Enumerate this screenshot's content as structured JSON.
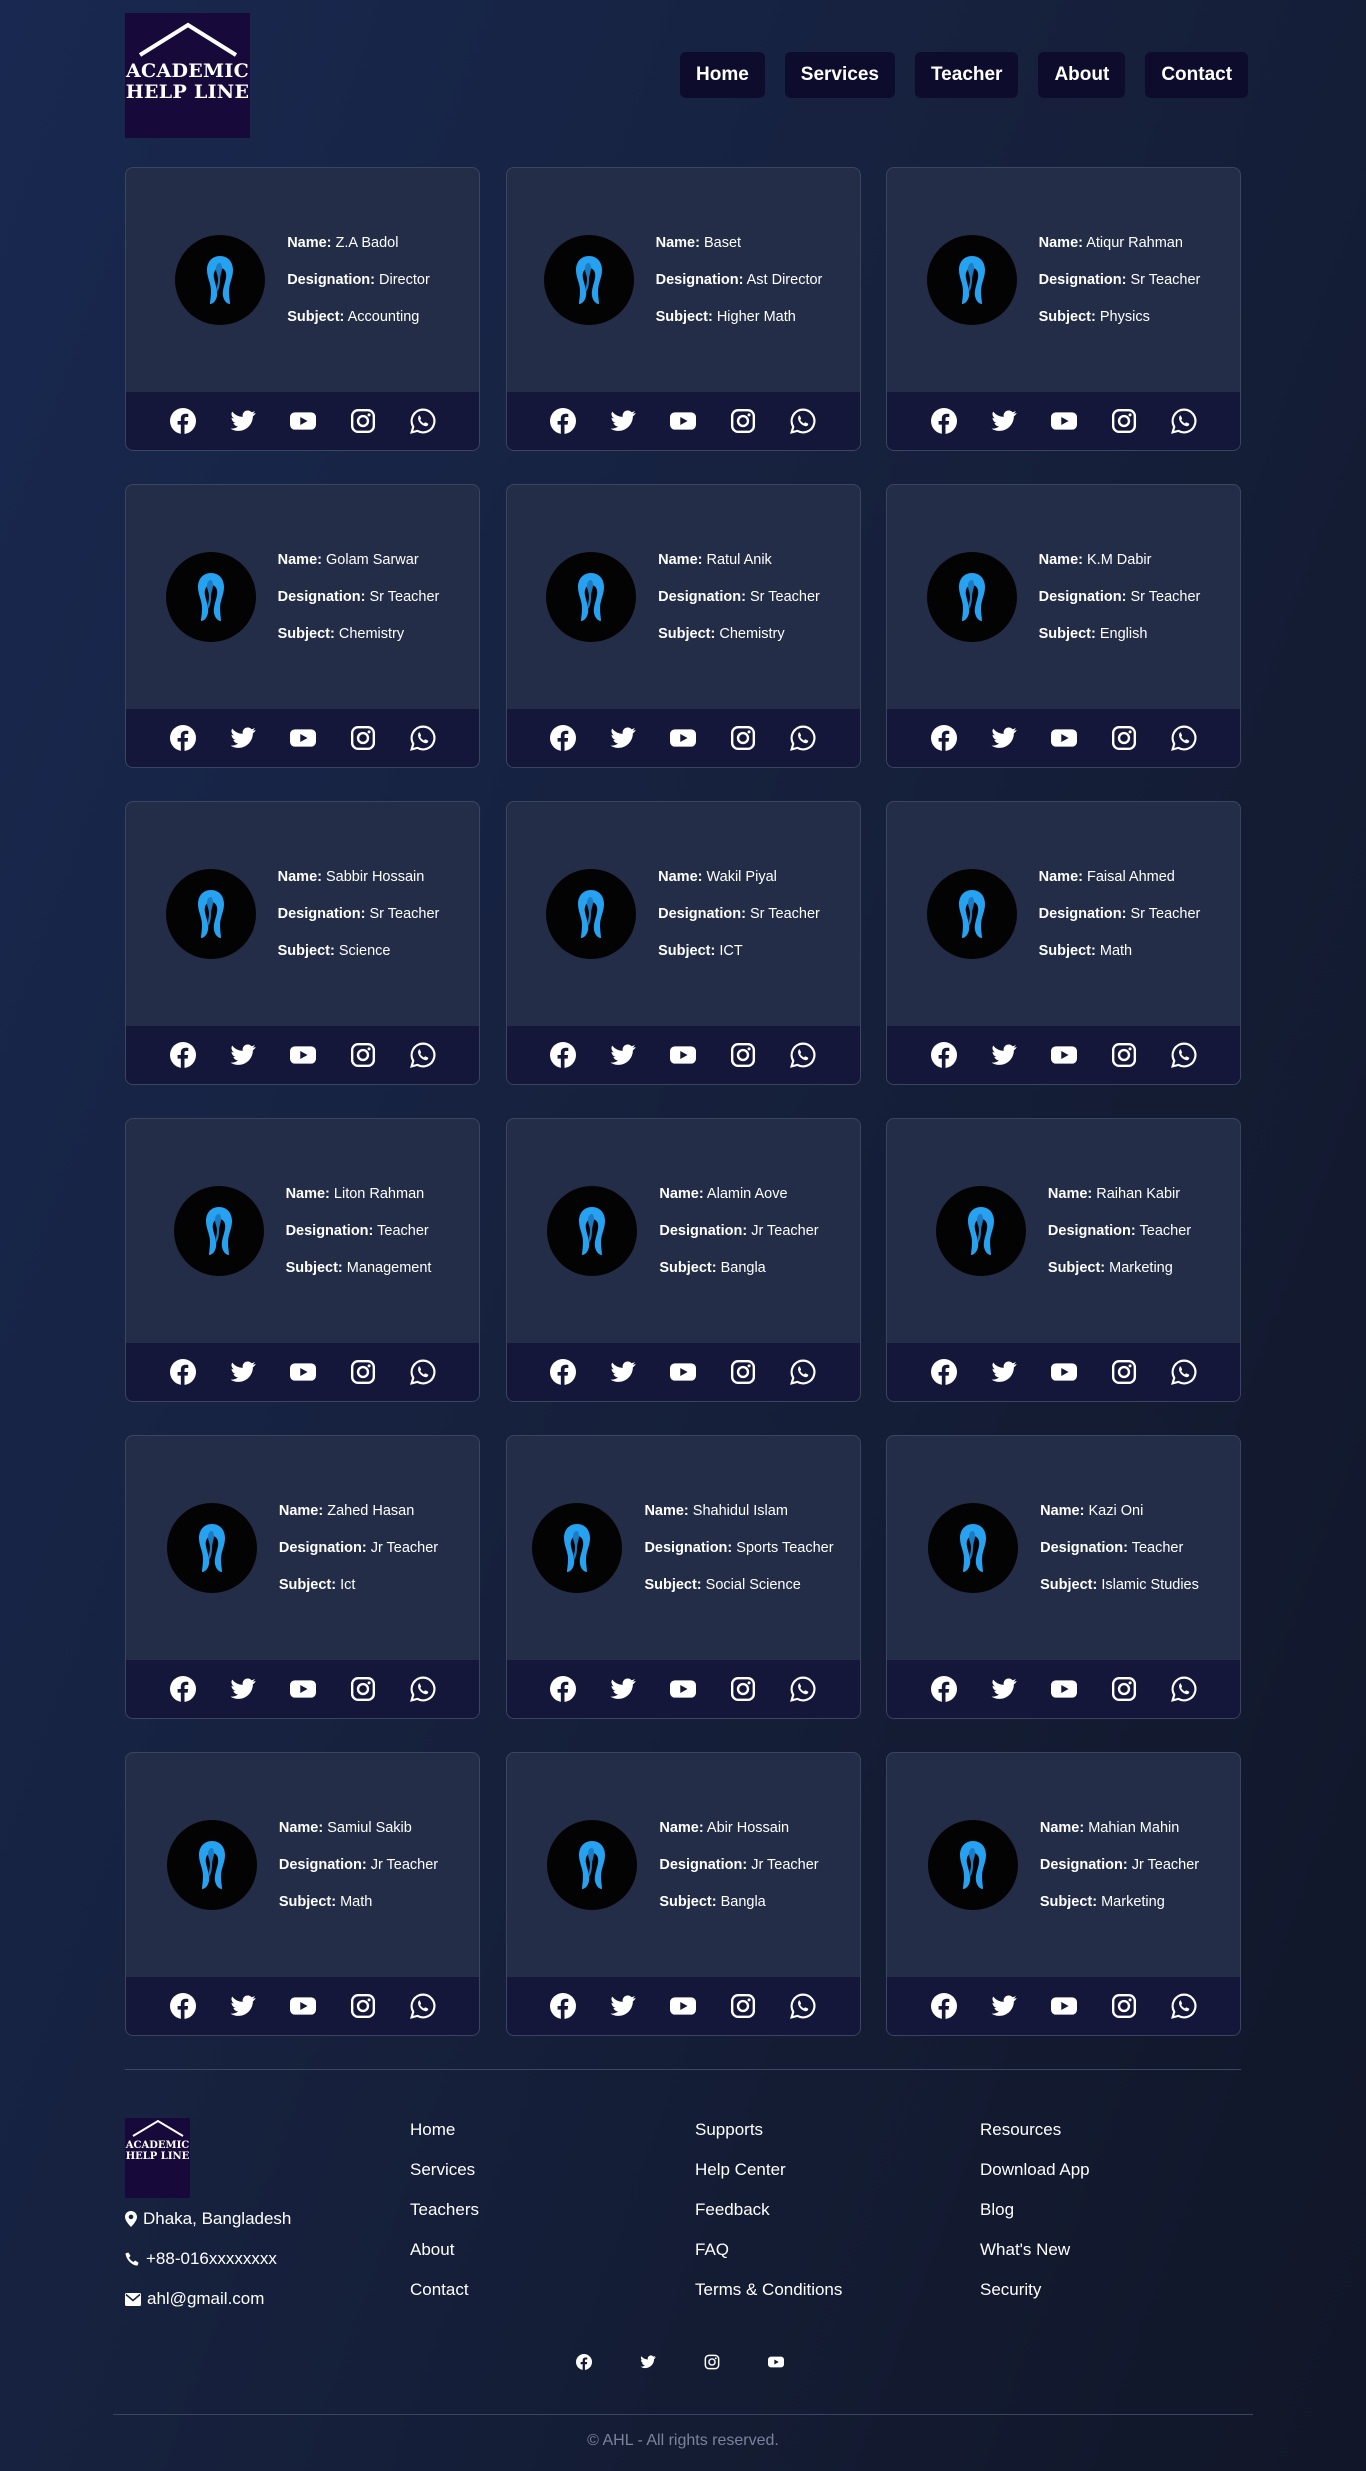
{
  "header": {
    "logo_line1": "ACADEMIC",
    "logo_line2": "HELP LINE",
    "nav": [
      {
        "label": "Home"
      },
      {
        "label": "Services"
      },
      {
        "label": "Teacher"
      },
      {
        "label": "About"
      },
      {
        "label": "Contact"
      }
    ]
  },
  "labels": {
    "name": "Name:",
    "designation": "Designation:",
    "subject": "Subject:"
  },
  "teachers": [
    {
      "name": "Z.A Badol",
      "designation": "Director",
      "subject": "Accounting"
    },
    {
      "name": "Baset",
      "designation": "Ast Director",
      "subject": "Higher Math"
    },
    {
      "name": "Atiqur Rahman",
      "designation": "Sr Teacher",
      "subject": "Physics"
    },
    {
      "name": "Golam Sarwar",
      "designation": "Sr Teacher",
      "subject": "Chemistry"
    },
    {
      "name": "Ratul Anik",
      "designation": "Sr Teacher",
      "subject": "Chemistry"
    },
    {
      "name": "K.M Dabir",
      "designation": "Sr Teacher",
      "subject": "English"
    },
    {
      "name": "Sabbir Hossain",
      "designation": "Sr Teacher",
      "subject": "Science"
    },
    {
      "name": "Wakil Piyal",
      "designation": "Sr Teacher",
      "subject": "ICT"
    },
    {
      "name": "Faisal Ahmed",
      "designation": "Sr Teacher",
      "subject": "Math"
    },
    {
      "name": "Liton Rahman",
      "designation": "Teacher",
      "subject": "Management"
    },
    {
      "name": "Alamin Aove",
      "designation": "Jr Teacher",
      "subject": "Bangla"
    },
    {
      "name": "Raihan Kabir",
      "designation": "Teacher",
      "subject": "Marketing"
    },
    {
      "name": "Zahed Hasan",
      "designation": "Jr Teacher",
      "subject": "Ict"
    },
    {
      "name": "Shahidul Islam",
      "designation": "Sports Teacher",
      "subject": "Social Science"
    },
    {
      "name": "Kazi Oni",
      "designation": "Teacher",
      "subject": "Islamic Studies"
    },
    {
      "name": "Samiul Sakib",
      "designation": "Jr Teacher",
      "subject": "Math"
    },
    {
      "name": "Abir Hossain",
      "designation": "Jr Teacher",
      "subject": "Bangla"
    },
    {
      "name": "Mahian Mahin",
      "designation": "Jr Teacher",
      "subject": "Marketing"
    }
  ],
  "card_social_icons": [
    "facebook-icon",
    "twitter-icon",
    "youtube-icon",
    "instagram-icon",
    "whatsapp-icon"
  ],
  "footer": {
    "logo_line1": "ACADEMIC",
    "logo_line2": "HELP LINE",
    "address": "Dhaka, Bangladesh",
    "phone": "+88-016xxxxxxxx",
    "email": "ahl@gmail.com",
    "col1": [
      "Home",
      "Services",
      "Teachers",
      "About",
      "Contact"
    ],
    "col2": [
      "Supports",
      "Help Center",
      "Feedback",
      "FAQ",
      "Terms & Conditions"
    ],
    "col3": [
      "Resources",
      "Download App",
      "Blog",
      "What's New",
      "Security"
    ],
    "social_icons": [
      "facebook-icon",
      "twitter-icon",
      "instagram-icon",
      "youtube-icon"
    ],
    "copyright": "© AHL - All rights reserved."
  },
  "colors": {
    "background_start": "#182850",
    "background_end": "#111628",
    "card": "#232d48",
    "card_social_bar": "#14163a",
    "nav_button": "#0e0c2c",
    "logo_bg": "#170a3a",
    "avatar_accent": "#27a2f0"
  }
}
